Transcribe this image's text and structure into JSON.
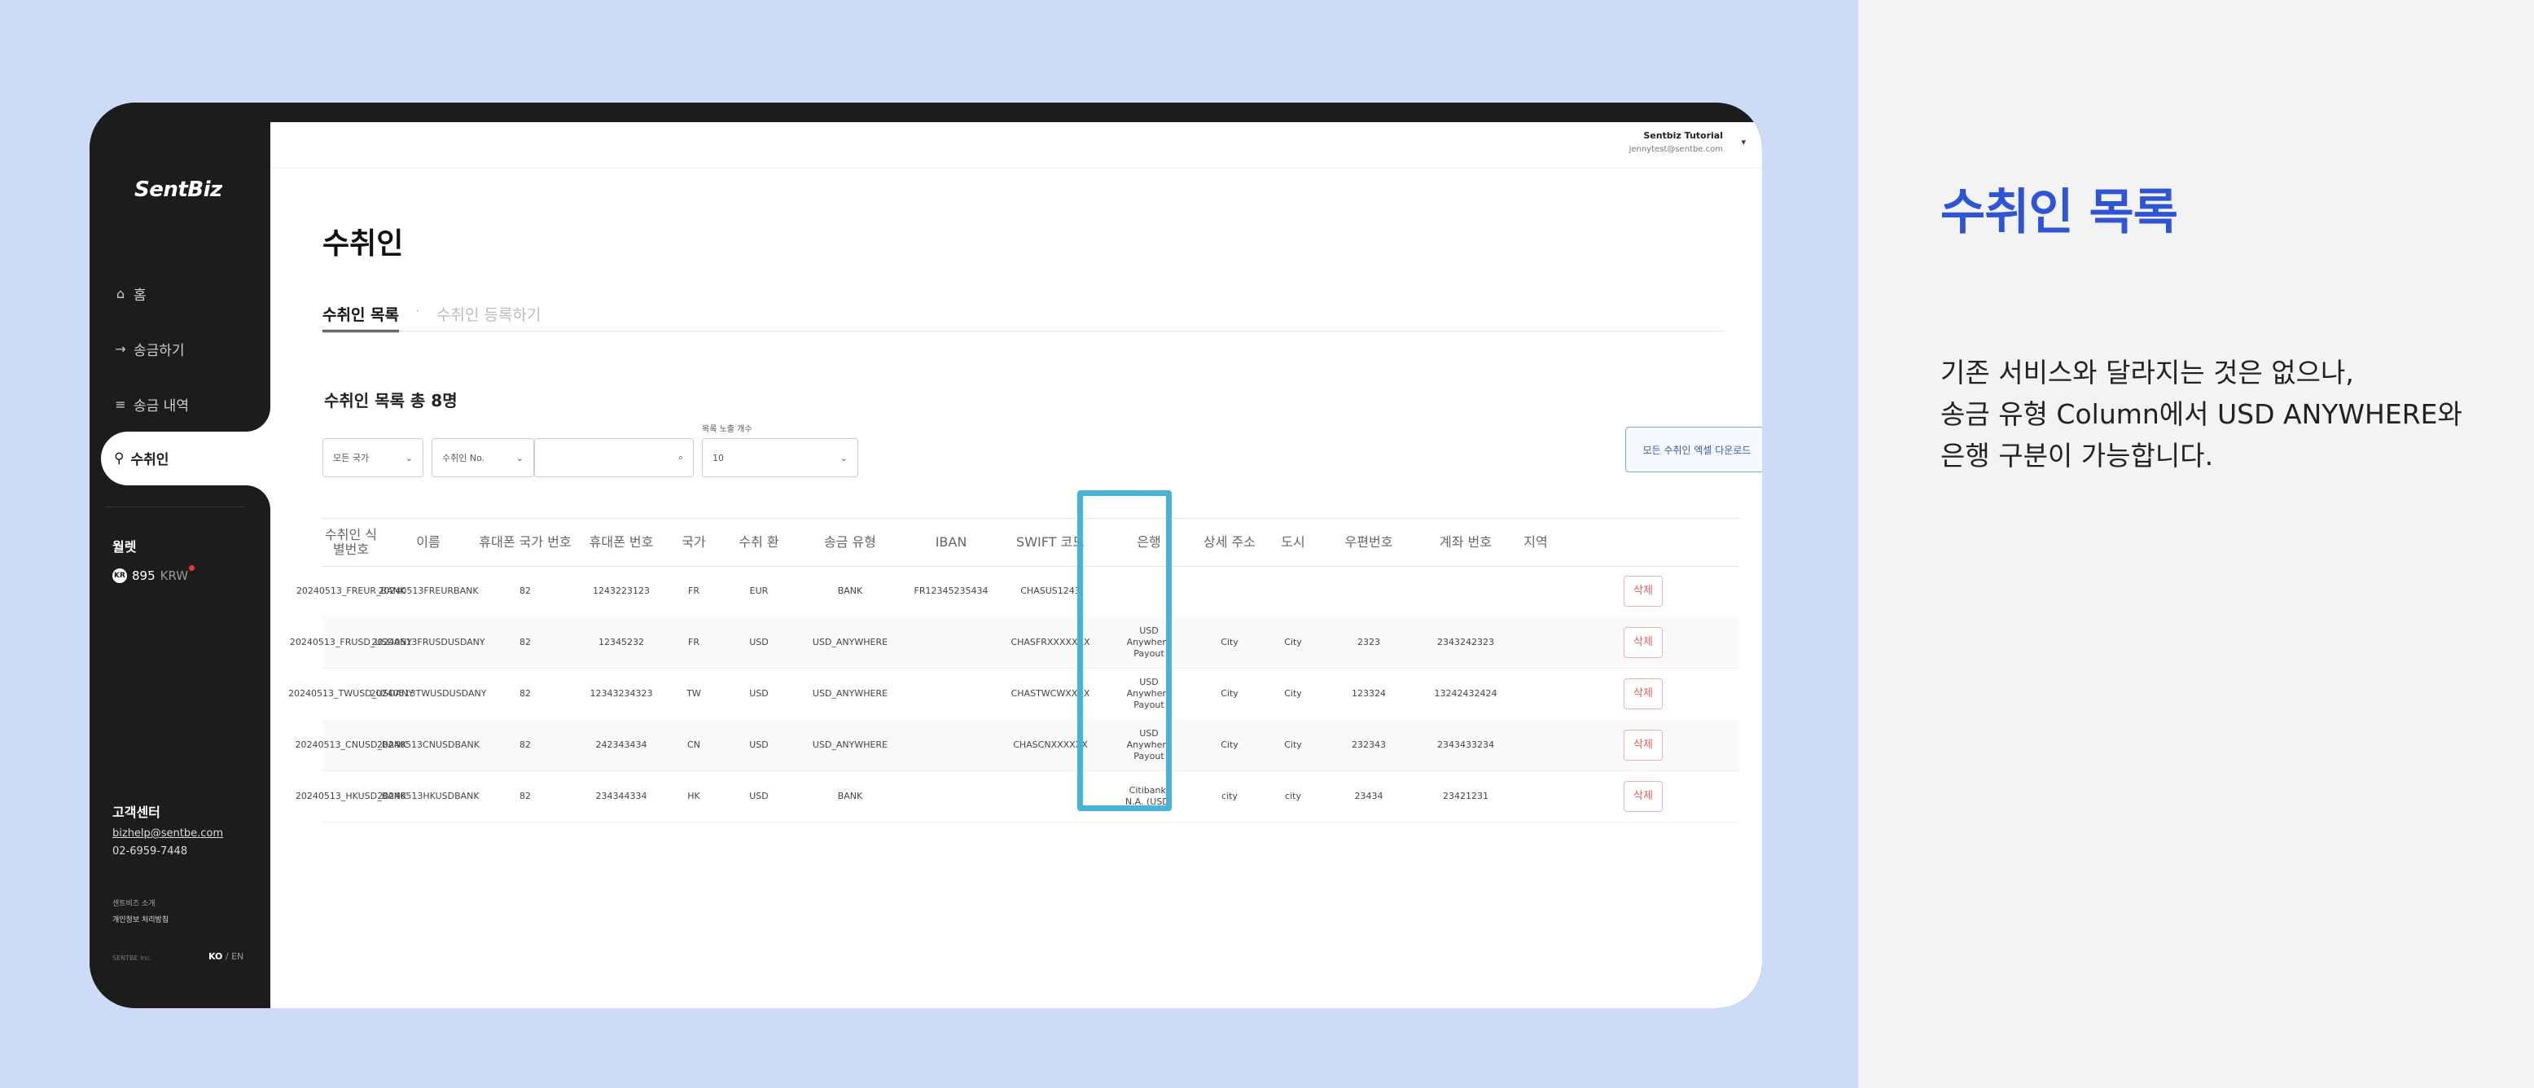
{
  "panel": {
    "title": "수취인 목록",
    "desc_lines": [
      "기존 서비스와 달라지는 것은 없으나,",
      "송금 유형 Column에서 USD ANYWHERE와",
      "은행 구분이 가능합니다."
    ]
  },
  "sidebar": {
    "logo": "SentBiz",
    "nav": [
      {
        "icon": "⌂",
        "label": "홈"
      },
      {
        "icon": "→",
        "label": "송금하기"
      },
      {
        "icon": "≡",
        "label": "송금 내역"
      },
      {
        "icon": "⚲",
        "label": "수취인"
      }
    ],
    "wallet": {
      "title": "월렛",
      "currency_flag": "KR",
      "amount": "895",
      "currency": "KRW"
    },
    "support": {
      "title": "고객센터",
      "email": "bizhelp@sentbe.com",
      "phone": "02-6959-7448"
    },
    "footer": {
      "about": "센트비즈 소개",
      "privacy": "개인정보 처리방침",
      "copyright": "SENTBE Inc."
    },
    "lang": {
      "ko": "KO",
      "sep": "/",
      "en": "EN"
    }
  },
  "topbar": {
    "user_name": "Sentbiz Tutorial",
    "user_email": "jennytest@sentbe.com",
    "caret": "▾"
  },
  "page": {
    "title": "수취인",
    "tabs": [
      {
        "label": "수취인 목록"
      },
      {
        "label": "수취인 등록하기"
      }
    ],
    "tab_sep": "·",
    "list_count": "수취인 목록 총 8명"
  },
  "filters": {
    "country": "모든 국가",
    "search_type": "수취인 No.",
    "search_value": "",
    "page_size_label": "목록 노출 개수",
    "page_size": "10",
    "search_icon": "⌕",
    "chevron": "⌄"
  },
  "download_label": "모든 수취인 엑셀 다운로드",
  "table": {
    "headers": [
      "수취인 식별번호",
      "이름",
      "휴대폰 국가 번호",
      "휴대폰 번호",
      "국가",
      "수취 환",
      "송금 유형",
      "IBAN",
      "SWIFT 코드",
      "은행",
      "상세 주소",
      "도시",
      "우편번호",
      "계좌 번호",
      "지역"
    ],
    "delete_label": "삭제",
    "rows": [
      [
        "20240513_FREUR_BANK",
        "20240513FREURBANK",
        "82",
        "1243223123",
        "FR",
        "EUR",
        "BANK",
        "FR12345235434",
        "CHASUS1243",
        "",
        "",
        "",
        "",
        "",
        ""
      ],
      [
        "20240513_FRUSD_USDANY",
        "20240513FRUSDUSDANY",
        "82",
        "12345232",
        "FR",
        "USD",
        "USD_ANYWHERE",
        "",
        "CHASFRXXXXXXX",
        "USD Anywhere Payout",
        "City",
        "City",
        "2323",
        "2343242323",
        ""
      ],
      [
        "20240513_TWUSD_USDANY",
        "20240513TWUSDUSDANY",
        "82",
        "12343234323",
        "TW",
        "USD",
        "USD_ANYWHERE",
        "",
        "CHASTWCWXXXX",
        "USD Anywhere Payout",
        "City",
        "City",
        "123324",
        "13242432424",
        ""
      ],
      [
        "20240513_CNUSD_BANK",
        "20240513CNUSDBANK",
        "82",
        "242343434",
        "CN",
        "USD",
        "USD_ANYWHERE",
        "",
        "CHASCNXXXXXX",
        "USD Anywhere Payout",
        "City",
        "City",
        "232343",
        "2343433234",
        ""
      ],
      [
        "20240513_HKUSD_BANK",
        "20240513HKUSDBANK",
        "82",
        "234344334",
        "HK",
        "USD",
        "BANK",
        "",
        "",
        "Citibank, N.A. (USD)",
        "city",
        "city",
        "23434",
        "23421231",
        ""
      ]
    ]
  }
}
